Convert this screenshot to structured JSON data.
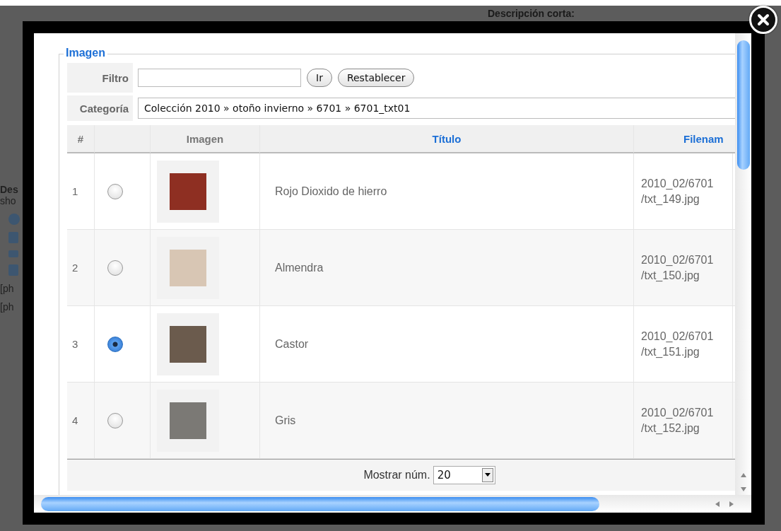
{
  "background_page": {
    "heading": "Descripción corta:",
    "fragments": [
      "Des",
      "sho",
      "[ph",
      "[ph"
    ]
  },
  "section": {
    "legend": "Imagen"
  },
  "filter": {
    "label": "Filtro",
    "buttons": [
      "Ir",
      "Restablecer"
    ]
  },
  "category": {
    "label": "Categoría",
    "value": "Colección 2010 » otoño invierno » 6701 » 6701_txt01"
  },
  "table": {
    "columns": [
      "#",
      "",
      "Imagen",
      "Título",
      "Filenam"
    ],
    "rows": [
      {
        "number": "1",
        "selected": false,
        "color": "#8e2f22",
        "title": "Rojo Dioxido de hierro",
        "filename": "2010_02/6701 /txt_149.jpg"
      },
      {
        "number": "2",
        "selected": false,
        "color": "#d8c6b4",
        "title": "Almendra",
        "filename": "2010_02/6701 /txt_150.jpg"
      },
      {
        "number": "3",
        "selected": true,
        "color": "#6b5b4d",
        "title": "Castor",
        "filename": "2010_02/6701 /txt_151.jpg"
      },
      {
        "number": "4",
        "selected": false,
        "color": "#7b7975",
        "title": "Gris",
        "filename": "2010_02/6701 /txt_152.jpg"
      }
    ]
  },
  "footer": {
    "label": "Mostrar núm.",
    "value": "20"
  }
}
